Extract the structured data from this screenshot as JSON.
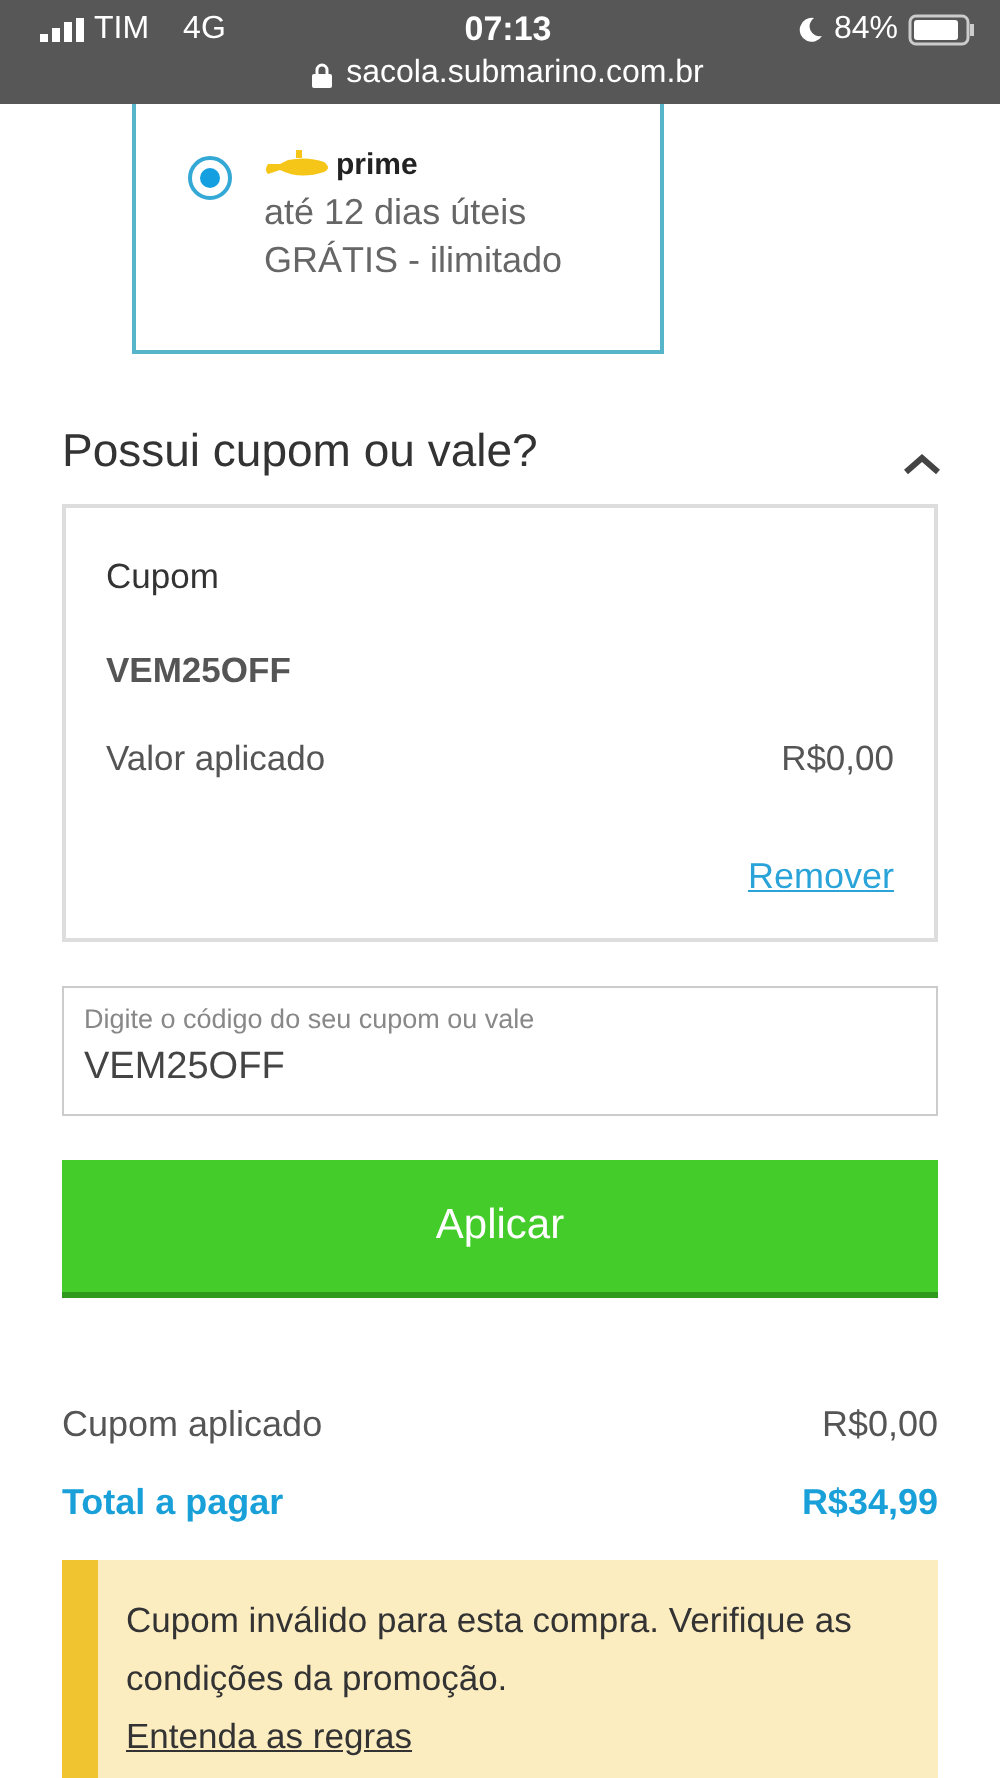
{
  "status_bar": {
    "carrier": "TIM",
    "network": "4G",
    "time": "07:13",
    "battery": "84%",
    "url": "sacola.submarino.com.br"
  },
  "shipping_option": {
    "selected": true,
    "logo_text": "prime",
    "lines": [
      "até 12 dias úteis",
      "GRÁTIS - ilimitado"
    ]
  },
  "coupon_section": {
    "title": "Possui cupom ou vale?",
    "expanded": true,
    "applied": {
      "label": "Cupom",
      "code": "VEM25OFF",
      "value_label": "Valor aplicado",
      "value": "R$0,00",
      "remove_link": "Remover"
    },
    "input": {
      "placeholder": "Digite o código do seu cupom ou vale",
      "value": "VEM25OFF"
    },
    "button": "Aplicar"
  },
  "summary": [
    {
      "kind": "normal",
      "label": "Cupom aplicado",
      "value": "R$0,00"
    },
    {
      "kind": "total",
      "label": "Total a pagar",
      "value": "R$34,99"
    }
  ],
  "alert": {
    "message": "Cupom inválido para esta compra. Verifique as condições da promoção.",
    "link": "Entenda as regras"
  }
}
